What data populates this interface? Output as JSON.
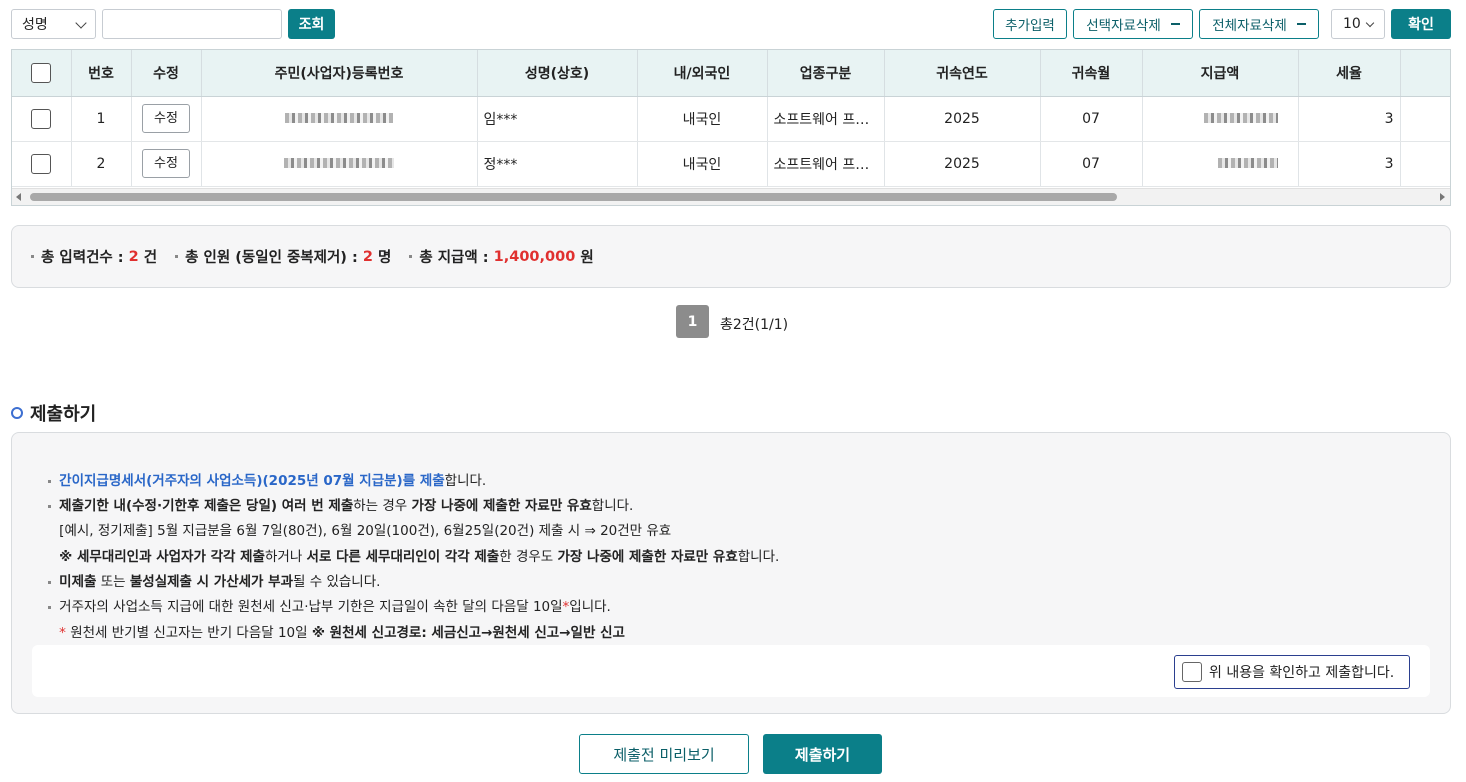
{
  "toolbar": {
    "search_field_selected": "성명",
    "search_input_value": "",
    "search_button": "조회",
    "add_button": "추가입력",
    "delete_selected_button": "선택자료삭제",
    "delete_all_button": "전체자료삭제",
    "page_size": "10",
    "confirm_button": "확인"
  },
  "table": {
    "headers": [
      "번호",
      "수정",
      "주민(사업자)등록번호",
      "성명(상호)",
      "내/외국인",
      "업종구분",
      "귀속연도",
      "귀속월",
      "지급액",
      "세율"
    ],
    "rows": [
      {
        "no": "1",
        "edit": "수정",
        "name": "임***",
        "nationality": "내국인",
        "business": "소프트웨어 프…",
        "year": "2025",
        "month": "07",
        "rate": "3"
      },
      {
        "no": "2",
        "edit": "수정",
        "name": "정***",
        "nationality": "내국인",
        "business": "소프트웨어 프…",
        "year": "2025",
        "month": "07",
        "rate": "3"
      }
    ]
  },
  "summary": {
    "count_label": "총 입력건수 : ",
    "count_value": "2",
    "count_unit": " 건",
    "persons_label": "총 인원 (동일인 중복제거) : ",
    "persons_value": "2",
    "persons_unit": " 명",
    "amount_label": "총 지급액 : ",
    "amount_value": "1,400,000",
    "amount_unit": " 원"
  },
  "pagination": {
    "current_page": "1",
    "info": "총2건(1/1)"
  },
  "submit_section": {
    "title": "제출하기",
    "line1_blue": "간이지급명세서(거주자의 사업소득)(2025년 07월 지급분)를 제출",
    "line1_rest": "합니다.",
    "line2_a": "제출기한 내(수정·기한후 제출은 당일) 여러 번 제출",
    "line2_b": "하는 경우 ",
    "line2_c": "가장 나중에 제출한 자료만 유효",
    "line2_d": "합니다.",
    "line3": "[예시, 정기제출] 5월 지급분을 6월 7일(80건), 6월 20일(100건), 6월25일(20건) 제출 시 ⇒ 20건만 유효",
    "line4_a": "※ 세무대리인과 사업자가 각각 제출",
    "line4_b": "하거나 ",
    "line4_c": "서로 다른 세무대리인이 각각 제출",
    "line4_d": "한 경우도 ",
    "line4_e": "가장 나중에 제출한 자료만 유효",
    "line4_f": "합니다.",
    "line5_a": "미제출",
    "line5_b": " 또는 ",
    "line5_c": "불성실제출 시 가산세가 부과",
    "line5_d": "될 수 있습니다.",
    "line6_a": "거주자의 사업소득 지급에 대한 원천세 신고·납부 기한은 지급일이 속한 달의 다음달 10일",
    "line6_star": "*",
    "line6_b": "입니다.",
    "line7_star": "*",
    "line7_a": " 원천세 반기별 신고자는 반기 다음달 10일 ",
    "line7_b": "※ 원천세 신고경로: 세금신고→원천세 신고→일반 신고",
    "confirm_checkbox_label": "위 내용을 확인하고 제출합니다."
  },
  "actions": {
    "preview_button": "제출전 미리보기",
    "submit_button": "제출하기"
  },
  "colors": {
    "primary": "#0b7f89",
    "highlight_red": "#e0302f",
    "link_blue": "#2a67c8"
  }
}
